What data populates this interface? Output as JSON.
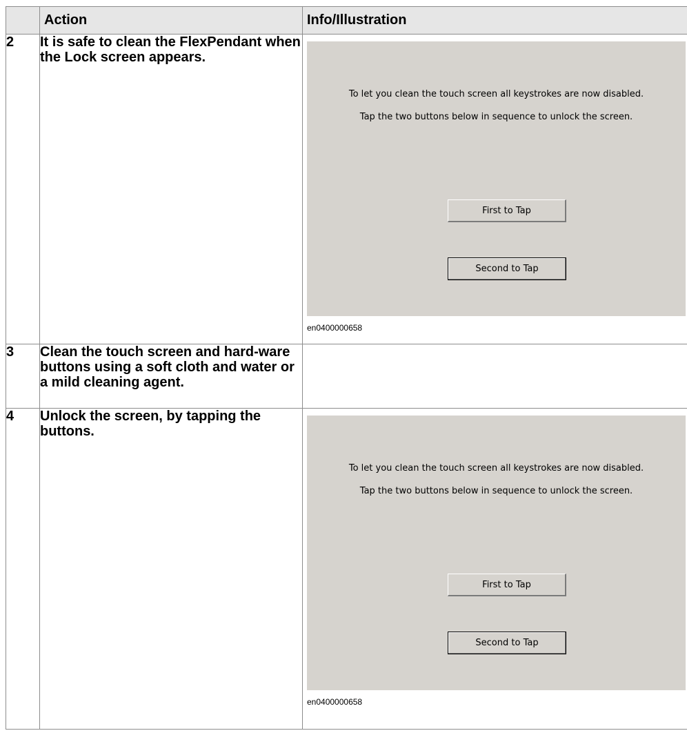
{
  "table": {
    "headers": {
      "number": "",
      "action": "Action",
      "info": "Info/Illustration"
    },
    "rows": [
      {
        "step": "2",
        "action": "It is safe to clean the FlexPendant when the Lock screen appears.",
        "illustration": {
          "message_line1": "To let you clean the touch screen all keystrokes are now disabled.",
          "message_line2": "Tap the two buttons below in sequence to unlock the screen.",
          "first_button": "First to Tap",
          "second_button": "Second to Tap",
          "caption": "en0400000658"
        }
      },
      {
        "step": "3",
        "action": "Clean the touch screen and hard-ware buttons using a soft cloth and water or a mild cleaning agent."
      },
      {
        "step": "4",
        "action": "Unlock the screen, by tapping the buttons.",
        "illustration": {
          "message_line1": "To let you clean the touch screen all keystrokes are now disabled.",
          "message_line2": "Tap the two buttons below in sequence to unlock the screen.",
          "first_button": "First to Tap",
          "second_button": "Second to Tap",
          "caption": "en0400000658"
        }
      }
    ]
  },
  "colors": {
    "header_background": "#e6e6e6",
    "illustration_background": "#d6d3ce",
    "border": "#8c8c8c"
  }
}
